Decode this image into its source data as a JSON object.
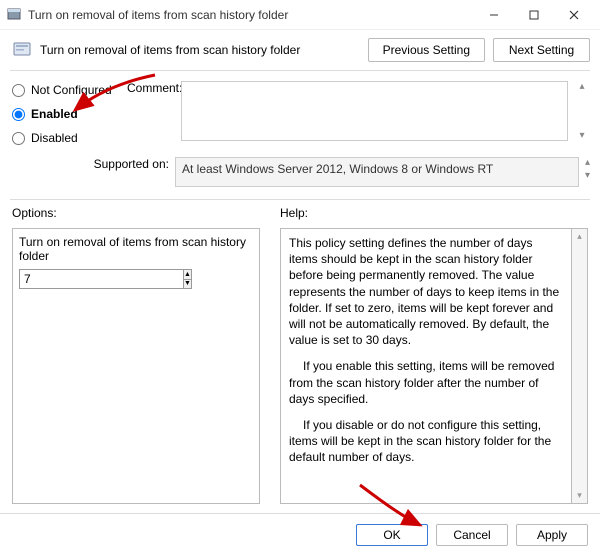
{
  "titlebar": {
    "title": "Turn on removal of items from scan history folder"
  },
  "header": {
    "title": "Turn on removal of items from scan history folder",
    "prev_btn": "Previous Setting",
    "next_btn": "Next Setting"
  },
  "radios": {
    "not_configured": "Not Configured",
    "enabled": "Enabled",
    "disabled": "Disabled",
    "selected": "enabled"
  },
  "comment": {
    "label": "Comment:",
    "value": ""
  },
  "supported": {
    "label": "Supported on:",
    "text": "At least Windows Server 2012, Windows 8 or Windows RT"
  },
  "options": {
    "panel_label": "Options:",
    "setting_label": "Turn on removal of items from scan history folder",
    "value": "7"
  },
  "help": {
    "panel_label": "Help:",
    "p1": "This policy setting defines the number of days items should be kept in the scan history folder before being permanently removed. The value represents the number of days to keep items in the folder. If set to zero, items will be kept forever and will not be automatically removed. By default, the value is set to 30 days.",
    "p2": "If you enable this setting, items will be removed from the scan history folder after the number of days specified.",
    "p3": "If you disable or do not configure this setting, items will be kept in the scan history folder for the default number of days."
  },
  "footer": {
    "ok": "OK",
    "cancel": "Cancel",
    "apply": "Apply"
  },
  "colors": {
    "accent": "#3a78d6",
    "arrow": "#cc0000"
  }
}
